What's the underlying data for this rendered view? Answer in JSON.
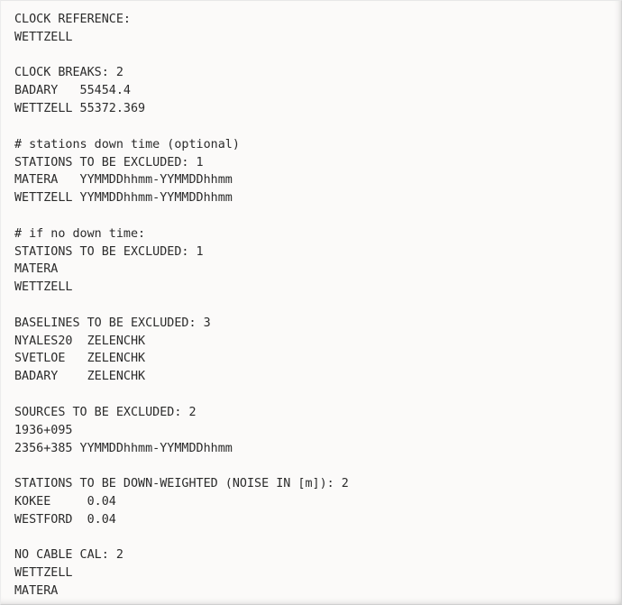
{
  "panel": {
    "kind": "plain-text-config-file",
    "background_color": "#fbfaf9",
    "text_color": "#2b2b2b",
    "border_color": "#d6d6d6"
  },
  "document": {
    "lines": [
      "CLOCK REFERENCE:",
      "WETTZELL",
      "",
      "CLOCK BREAKS: 2",
      "BADARY   55454.4",
      "WETTZELL 55372.369",
      "",
      "# stations down time (optional)",
      "STATIONS TO BE EXCLUDED: 1",
      "MATERA   YYMMDDhhmm-YYMMDDhhmm",
      "WETTZELL YYMMDDhhmm-YYMMDDhhmm",
      "",
      "# if no down time:",
      "STATIONS TO BE EXCLUDED: 1",
      "MATERA",
      "WETTZELL",
      "",
      "BASELINES TO BE EXCLUDED: 3",
      "NYALES20  ZELENCHK",
      "SVETLOE   ZELENCHK",
      "BADARY    ZELENCHK",
      "",
      "SOURCES TO BE EXCLUDED: 2",
      "1936+095",
      "2356+385 YYMMDDhhmm-YYMMDDhhmm",
      "",
      "STATIONS TO BE DOWN-WEIGHTED (NOISE IN [m]): 2",
      "KOKEE     0.04",
      "WESTFORD  0.04",
      "",
      "NO CABLE CAL: 2",
      "WETTZELL",
      "MATERA"
    ],
    "sections": [
      {
        "header": "CLOCK REFERENCE:",
        "count": null,
        "entries": [
          {
            "name": "WETTZELL",
            "value": ""
          }
        ]
      },
      {
        "header": "CLOCK BREAKS: 2",
        "count": 2,
        "entries": [
          {
            "name": "BADARY",
            "value": "55454.4"
          },
          {
            "name": "WETTZELL",
            "value": "55372.369"
          }
        ]
      },
      {
        "comment": "# stations down time (optional)",
        "header": "STATIONS TO BE EXCLUDED: 1",
        "count": 1,
        "entries": [
          {
            "name": "MATERA",
            "value": "YYMMDDhhmm-YYMMDDhhmm"
          },
          {
            "name": "WETTZELL",
            "value": "YYMMDDhhmm-YYMMDDhhmm"
          }
        ]
      },
      {
        "comment": "# if no down time:",
        "header": "STATIONS TO BE EXCLUDED: 1",
        "count": 1,
        "entries": [
          {
            "name": "MATERA",
            "value": ""
          },
          {
            "name": "WETTZELL",
            "value": ""
          }
        ]
      },
      {
        "header": "BASELINES TO BE EXCLUDED: 3",
        "count": 3,
        "entries": [
          {
            "name": "NYALES20",
            "value": "ZELENCHK"
          },
          {
            "name": "SVETLOE",
            "value": "ZELENCHK"
          },
          {
            "name": "BADARY",
            "value": "ZELENCHK"
          }
        ]
      },
      {
        "header": "SOURCES TO BE EXCLUDED: 2",
        "count": 2,
        "entries": [
          {
            "name": "1936+095",
            "value": ""
          },
          {
            "name": "2356+385",
            "value": "YYMMDDhhmm-YYMMDDhhmm"
          }
        ]
      },
      {
        "header": "STATIONS TO BE DOWN-WEIGHTED (NOISE IN [m]): 2",
        "count": 2,
        "entries": [
          {
            "name": "KOKEE",
            "value": "0.04"
          },
          {
            "name": "WESTFORD",
            "value": "0.04"
          }
        ]
      },
      {
        "header": "NO CABLE CAL: 2",
        "count": 2,
        "entries": [
          {
            "name": "WETTZELL",
            "value": ""
          },
          {
            "name": "MATERA",
            "value": ""
          }
        ]
      }
    ]
  }
}
